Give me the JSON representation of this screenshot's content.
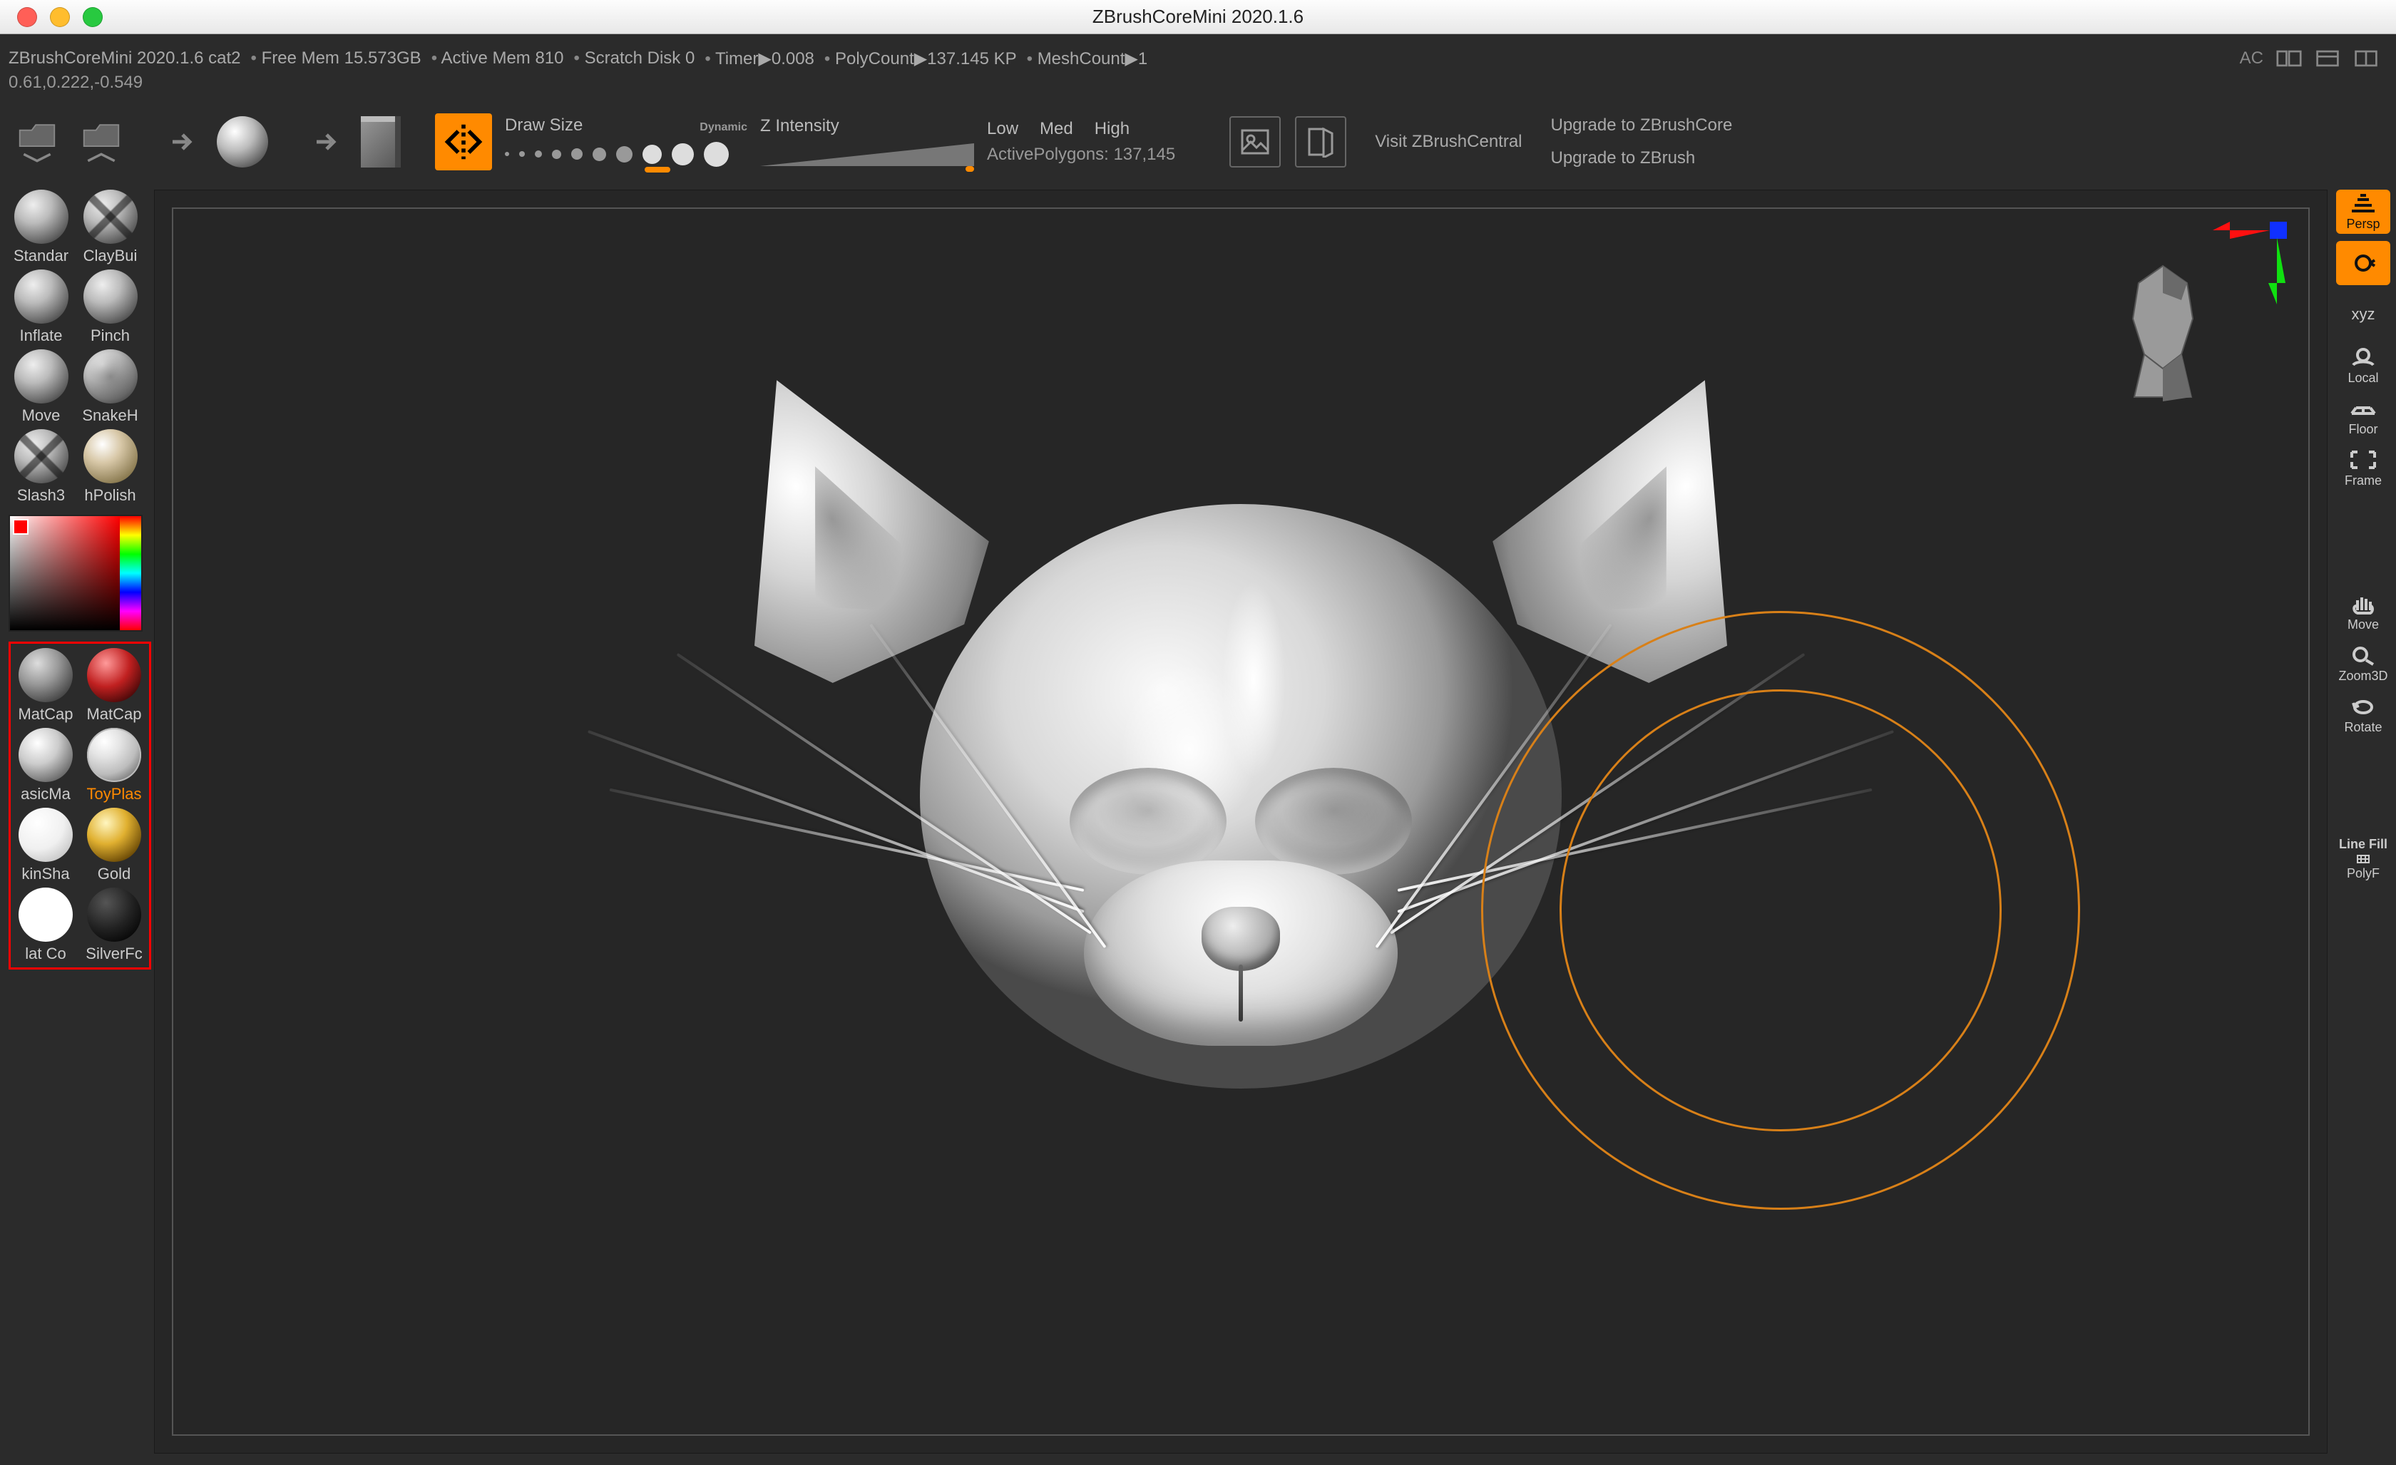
{
  "window": {
    "title": "ZBrushCoreMini 2020.1.6"
  },
  "status": {
    "doc": "ZBrushCoreMini 2020.1.6 cat2",
    "free_mem": "Free Mem 15.573GB",
    "active_mem": "Active Mem 810",
    "scratch": "Scratch Disk 0",
    "timer": "Timer▶0.008",
    "polycount": "PolyCount▶137.145 KP",
    "meshcount": "MeshCount▶1",
    "ac": "AC"
  },
  "coords": "0.61,0.222,-0.549",
  "toolbar": {
    "drawsize_label": "Draw Size",
    "dynamic_label": "Dynamic",
    "zintensity_label": "Z Intensity",
    "quality_low": "Low",
    "quality_med": "Med",
    "quality_high": "High",
    "active_polys_label": "ActivePolygons:",
    "active_polys_value": "137,145",
    "visit_label": "Visit ZBrushCentral",
    "upgrade_core": "Upgrade to ZBrushCore",
    "upgrade_full": "Upgrade to ZBrush"
  },
  "brushes": [
    {
      "label": "Standar"
    },
    {
      "label": "ClayBui"
    },
    {
      "label": "Inflate"
    },
    {
      "label": "Pinch"
    },
    {
      "label": "Move"
    },
    {
      "label": "SnakeH"
    },
    {
      "label": "Slash3"
    },
    {
      "label": "hPolish"
    }
  ],
  "materials": [
    {
      "label": "MatCap"
    },
    {
      "label": "MatCap"
    },
    {
      "label": "asicMa"
    },
    {
      "label": "ToyPlas"
    },
    {
      "label": "kinSha"
    },
    {
      "label": "Gold"
    },
    {
      "label": "lat Co"
    },
    {
      "label": "SilverFc"
    }
  ],
  "right_tools": {
    "persp": "Persp",
    "xyz": "xyz",
    "local": "Local",
    "floor": "Floor",
    "frame": "Frame",
    "move": "Move",
    "zoom3d": "Zoom3D",
    "rotate": "Rotate",
    "linefill": "Line Fill",
    "polyf": "PolyF"
  }
}
